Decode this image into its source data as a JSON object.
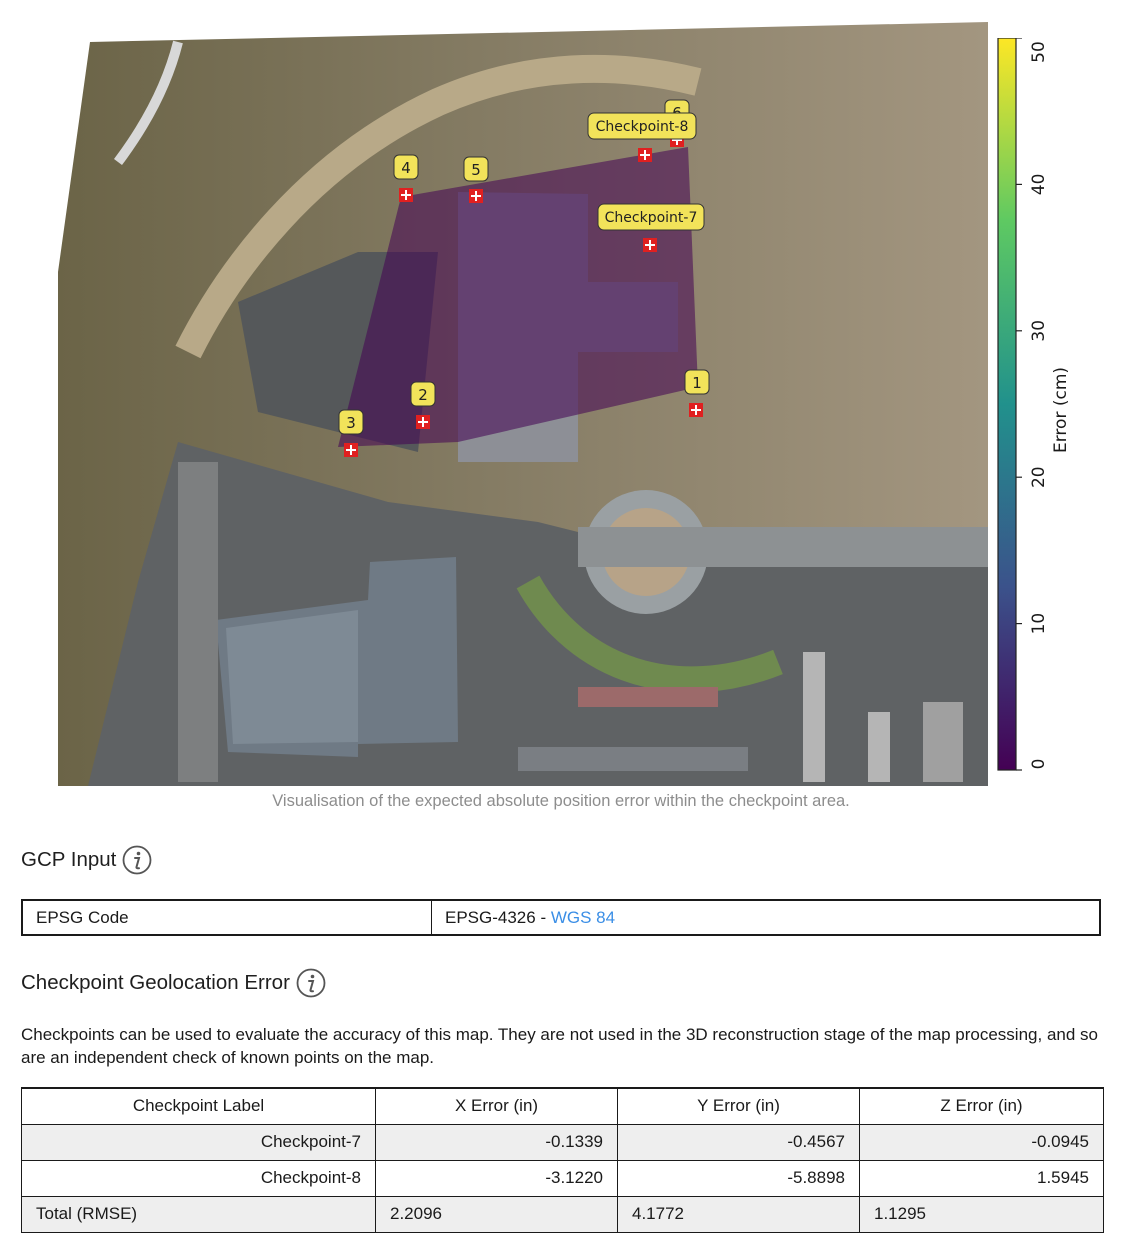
{
  "map": {
    "markers": [
      {
        "label": "1"
      },
      {
        "label": "2"
      },
      {
        "label": "3"
      },
      {
        "label": "4"
      },
      {
        "label": "5"
      },
      {
        "label": "6"
      },
      {
        "label": "Checkpoint-7"
      },
      {
        "label": "Checkpoint-8"
      }
    ],
    "colorbar": {
      "label": "Error (cm)",
      "ticks": [
        "0",
        "10",
        "20",
        "30",
        "40",
        "50"
      ],
      "colormap": [
        "#440154",
        "#3b528b",
        "#21918c",
        "#5ec962",
        "#fde725"
      ]
    },
    "caption": "Visualisation of the expected absolute position error within the checkpoint area."
  },
  "gcp_input": {
    "title": "GCP Input",
    "info_icon": "info-icon",
    "epsg_label": "EPSG Code",
    "epsg_value_prefix": "EPSG-4326 - ",
    "epsg_link": "WGS 84"
  },
  "checkpoint_error": {
    "title": "Checkpoint Geolocation Error",
    "info_icon": "info-icon",
    "description": "Checkpoints can be used to evaluate the accuracy of this map. They are not used in the 3D reconstruction stage of the map processing, and so are an independent check of known points on the map.",
    "table": {
      "headers": [
        "Checkpoint Label",
        "X Error (in)",
        "Y Error (in)",
        "Z Error (in)"
      ],
      "rows": [
        [
          "Checkpoint-7",
          "-0.1339",
          "-0.4567",
          "-0.0945"
        ],
        [
          "Checkpoint-8",
          "-3.1220",
          "-5.8898",
          "1.5945"
        ]
      ],
      "total": [
        "Total (RMSE)",
        "2.2096",
        "4.1772",
        "1.1295"
      ]
    }
  }
}
